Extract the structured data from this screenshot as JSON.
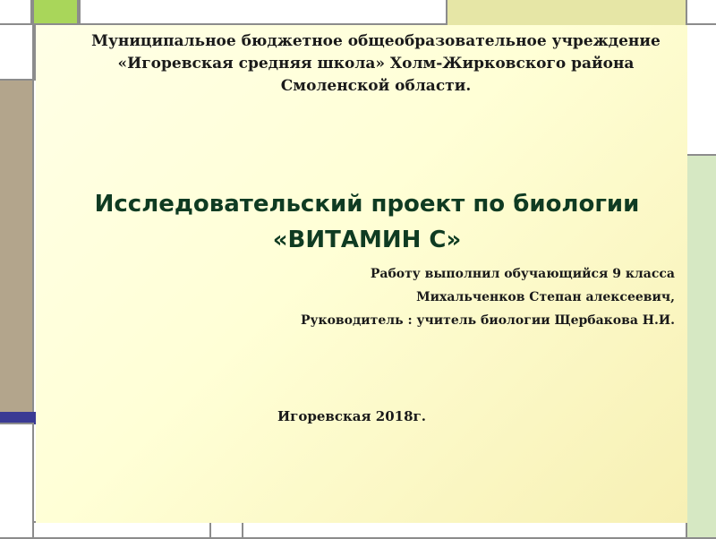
{
  "slide": {
    "organization": [
      "Муниципальное бюджетное общеобразовательное учреждение",
      "«Игоревская средняя школа» Холм-Жирковского района",
      "Смоленской области."
    ],
    "title": [
      "Исследовательский проект по биологии",
      "«ВИТАМИН С»"
    ],
    "performer": "Работу выполнил обучающийся 9 класса",
    "student": "Михальченков Степан алексеевич,",
    "supervisor": "Руководитель : учитель биологии Щербакова Н.И.",
    "place_year": "Игоревская 2018г."
  },
  "colors": {
    "frame": "#8c8c8c",
    "green_accent": "#a9d65a",
    "olive_light": "#e6e6a6",
    "tan": "#b3a58c",
    "navy_stripe": "#3a3a94",
    "light_green_panel": "#d6e8c3",
    "title_color": "#0f3b22"
  }
}
